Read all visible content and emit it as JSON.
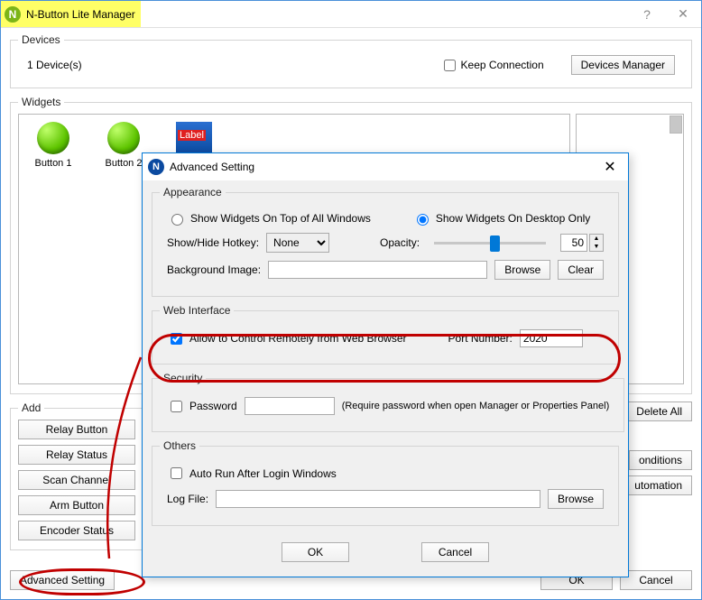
{
  "title": "N-Button Lite Manager",
  "devices": {
    "count_label": "1 Device(s)",
    "keep_connection_label": "Keep Connection",
    "manager_btn": "Devices Manager"
  },
  "widgets": {
    "legend": "Widgets",
    "items": [
      {
        "label": "Button 1",
        "kind": "button"
      },
      {
        "label": "Button 2",
        "kind": "button"
      },
      {
        "label": "Label 1",
        "kind": "label"
      }
    ]
  },
  "add": {
    "legend": "Add",
    "buttons": [
      "Relay Button",
      "Relay Status",
      "Scan Channel",
      "Arm Button",
      "Encoder Status"
    ]
  },
  "right": {
    "delete_all": "Delete All",
    "conditions": "onditions",
    "automation": "utomation"
  },
  "footer": {
    "advanced": "Advanced Setting",
    "ok": "OK",
    "cancel": "Cancel"
  },
  "dialog": {
    "title": "Advanced Setting",
    "appearance": {
      "legend": "Appearance",
      "radio_top": "Show Widgets On Top of All Windows",
      "radio_desktop": "Show Widgets On Desktop Only",
      "hotkey_label": "Show/Hide Hotkey:",
      "hotkey_value": "None",
      "opacity_label": "Opacity:",
      "opacity_value": "50",
      "bg_label": "Background Image:",
      "browse": "Browse",
      "clear": "Clear"
    },
    "web": {
      "legend": "Web Interface",
      "allow_label": "Allow to Control Remotely from Web Browser",
      "allow_checked": true,
      "port_label": "Port Number:",
      "port_value": "2020"
    },
    "security": {
      "legend": "Security",
      "password_label": "Password",
      "hint": "(Require password when open Manager or Properties Panel)"
    },
    "others": {
      "legend": "Others",
      "autorun_label": "Auto Run After Login Windows",
      "log_label": "Log File:",
      "browse": "Browse"
    },
    "ok": "OK",
    "cancel": "Cancel"
  }
}
